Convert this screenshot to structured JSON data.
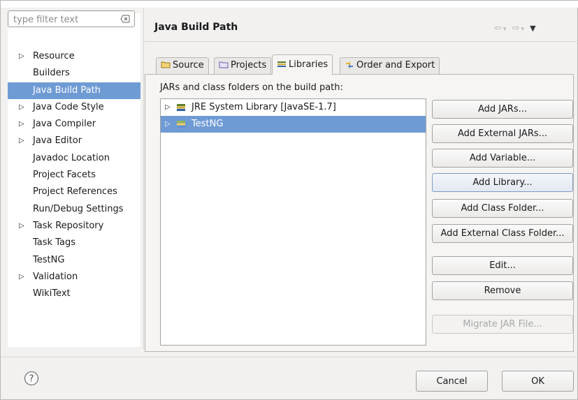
{
  "filter": {
    "placeholder": "type filter text"
  },
  "tree": [
    {
      "label": "Resource",
      "expandable": true
    },
    {
      "label": "Builders",
      "expandable": false
    },
    {
      "label": "Java Build Path",
      "expandable": false,
      "selected": true
    },
    {
      "label": "Java Code Style",
      "expandable": true
    },
    {
      "label": "Java Compiler",
      "expandable": true
    },
    {
      "label": "Java Editor",
      "expandable": true
    },
    {
      "label": "Javadoc Location",
      "expandable": false
    },
    {
      "label": "Project Facets",
      "expandable": false
    },
    {
      "label": "Project References",
      "expandable": false
    },
    {
      "label": "Run/Debug Settings",
      "expandable": false
    },
    {
      "label": "Task Repository",
      "expandable": true
    },
    {
      "label": "Task Tags",
      "expandable": false
    },
    {
      "label": "TestNG",
      "expandable": false
    },
    {
      "label": "Validation",
      "expandable": true
    },
    {
      "label": "WikiText",
      "expandable": false
    }
  ],
  "page": {
    "title": "Java Build Path"
  },
  "tabs": [
    {
      "label": "Source",
      "icon": "source-folder-icon"
    },
    {
      "label": "Projects",
      "icon": "projects-icon"
    },
    {
      "label": "Libraries",
      "icon": "libraries-icon",
      "active": true
    },
    {
      "label": "Order and Export",
      "icon": "order-export-icon"
    }
  ],
  "libraries": {
    "label": "JARs and class folders on the build path:",
    "items": [
      {
        "label": "JRE System Library [JavaSE-1.7]",
        "selected": false
      },
      {
        "label": "TestNG",
        "selected": true
      }
    ]
  },
  "buttons": {
    "add_jars": "Add JARs...",
    "add_external_jars": "Add External JARs...",
    "add_variable": "Add Variable...",
    "add_library": "Add Library...",
    "add_class_folder": "Add Class Folder...",
    "add_external_class_folder": "Add External Class Folder...",
    "edit": "Edit...",
    "remove": "Remove",
    "migrate_jar": "Migrate JAR File..."
  },
  "footer": {
    "cancel": "Cancel",
    "ok": "OK"
  },
  "colors": {
    "selection": "#6f9bd5"
  }
}
